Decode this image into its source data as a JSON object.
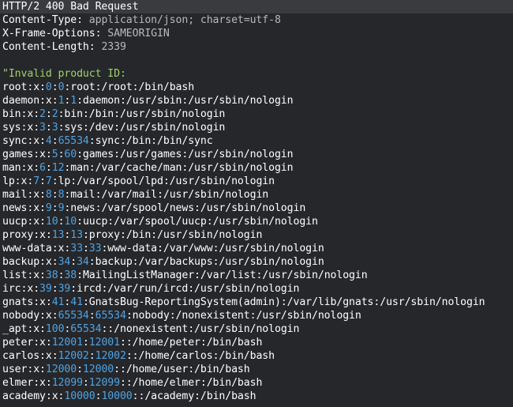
{
  "response": {
    "status_line": "HTTP/2 400 Bad Request",
    "headers": [
      {
        "name": "Content-Type",
        "value": "application/json; charset=utf-8"
      },
      {
        "name": "X-Frame-Options",
        "value": "SAMEORIGIN"
      },
      {
        "name": "Content-Length",
        "value": "2339"
      }
    ]
  },
  "body": {
    "prefix": "\"Invalid product ID:",
    "passwd_lines": [
      {
        "user": "root",
        "uid": "0",
        "gid": "0",
        "rest": ":root:/root:/bin/bash"
      },
      {
        "user": "daemon",
        "uid": "1",
        "gid": "1",
        "rest": ":daemon:/usr/sbin:/usr/sbin/nologin"
      },
      {
        "user": "bin",
        "uid": "2",
        "gid": "2",
        "rest": ":bin:/bin:/usr/sbin/nologin"
      },
      {
        "user": "sys",
        "uid": "3",
        "gid": "3",
        "rest": ":sys:/dev:/usr/sbin/nologin"
      },
      {
        "user": "sync",
        "uid": "4",
        "gid": "65534",
        "rest": ":sync:/bin:/bin/sync"
      },
      {
        "user": "games",
        "uid": "5",
        "gid": "60",
        "rest": ":games:/usr/games:/usr/sbin/nologin"
      },
      {
        "user": "man",
        "uid": "6",
        "gid": "12",
        "rest": ":man:/var/cache/man:/usr/sbin/nologin"
      },
      {
        "user": "lp",
        "uid": "7",
        "gid": "7",
        "rest": ":lp:/var/spool/lpd:/usr/sbin/nologin"
      },
      {
        "user": "mail",
        "uid": "8",
        "gid": "8",
        "rest": ":mail:/var/mail:/usr/sbin/nologin"
      },
      {
        "user": "news",
        "uid": "9",
        "gid": "9",
        "rest": ":news:/var/spool/news:/usr/sbin/nologin"
      },
      {
        "user": "uucp",
        "uid": "10",
        "gid": "10",
        "rest": ":uucp:/var/spool/uucp:/usr/sbin/nologin"
      },
      {
        "user": "proxy",
        "uid": "13",
        "gid": "13",
        "rest": ":proxy:/bin:/usr/sbin/nologin"
      },
      {
        "user": "www-data",
        "uid": "33",
        "gid": "33",
        "rest": ":www-data:/var/www:/usr/sbin/nologin"
      },
      {
        "user": "backup",
        "uid": "34",
        "gid": "34",
        "rest": ":backup:/var/backups:/usr/sbin/nologin"
      },
      {
        "user": "list",
        "uid": "38",
        "gid": "38",
        "rest": ":MailingListManager:/var/list:/usr/sbin/nologin"
      },
      {
        "user": "irc",
        "uid": "39",
        "gid": "39",
        "rest": ":ircd:/var/run/ircd:/usr/sbin/nologin"
      },
      {
        "user": "gnats",
        "uid": "41",
        "gid": "41",
        "rest": ":GnatsBug-ReportingSystem(admin):/var/lib/gnats:/usr/sbin/nologin"
      },
      {
        "user": "nobody",
        "uid": "65534",
        "gid": "65534",
        "rest": ":nobody:/nonexistent:/usr/sbin/nologin"
      },
      {
        "user": "_apt",
        "uid": "100",
        "gid": "65534",
        "rest": "::/nonexistent:/usr/sbin/nologin"
      },
      {
        "user": "peter",
        "uid": "12001",
        "gid": "12001",
        "rest": "::/home/peter:/bin/bash"
      },
      {
        "user": "carlos",
        "uid": "12002",
        "gid": "12002",
        "rest": "::/home/carlos:/bin/bash"
      },
      {
        "user": "user",
        "uid": "12000",
        "gid": "12000",
        "rest": "::/home/user:/bin/bash"
      },
      {
        "user": "elmer",
        "uid": "12099",
        "gid": "12099",
        "rest": "::/home/elmer:/bin/bash"
      },
      {
        "user": "academy",
        "uid": "10000",
        "gid": "10000",
        "rest": "::/academy:/bin/bash"
      }
    ]
  },
  "colors": {
    "background": "#26272b",
    "status_bg": "#3a3b3f",
    "string": "#9fd36a",
    "number": "#4fa3e3",
    "header_value": "#b9b9b9"
  }
}
